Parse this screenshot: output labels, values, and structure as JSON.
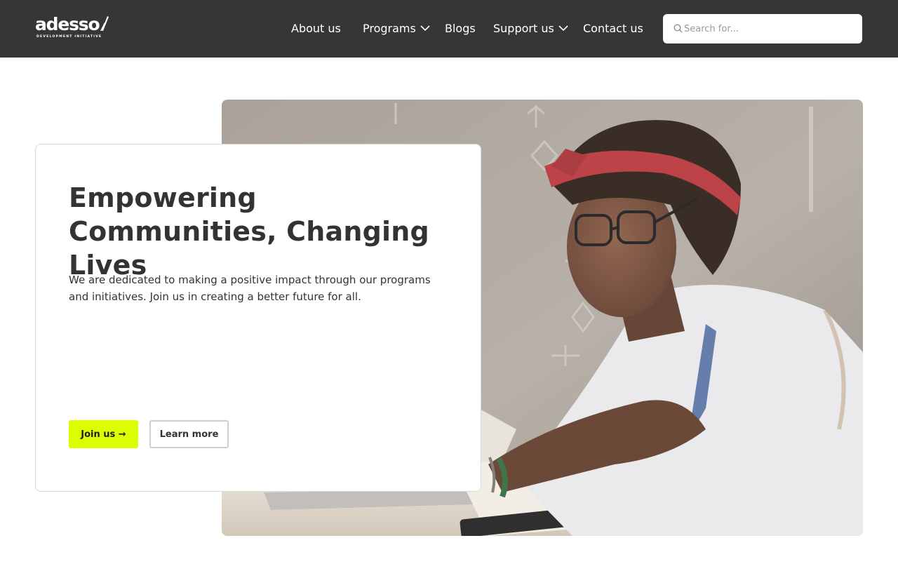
{
  "header": {
    "logo": {
      "name": "adesso",
      "subtitle": "DEVELOPMENT INITIATIVE"
    },
    "nav": [
      {
        "label": "About us",
        "has_dropdown": false
      },
      {
        "label": "Programs",
        "has_dropdown": true
      },
      {
        "label": "Blogs",
        "has_dropdown": false
      },
      {
        "label": "Support us",
        "has_dropdown": true
      },
      {
        "label": "Contact us",
        "has_dropdown": false
      }
    ],
    "search": {
      "placeholder": "Search for...",
      "value": "",
      "icon": "search-icon"
    }
  },
  "hero": {
    "title": "Empowering Communities, Changing Lives",
    "text": "We are dedicated to making a positive impact through our programs and initiatives. Join us in creating a better future for all.",
    "primary_button": "Join us →",
    "secondary_button": "Learn more",
    "image": "photo of a young woman with red bandana and glasses writing at a table"
  },
  "colors": {
    "header_bg": "#363636",
    "accent": "#dcff00",
    "text": "#333333",
    "card_border": "#d9d9d9"
  }
}
